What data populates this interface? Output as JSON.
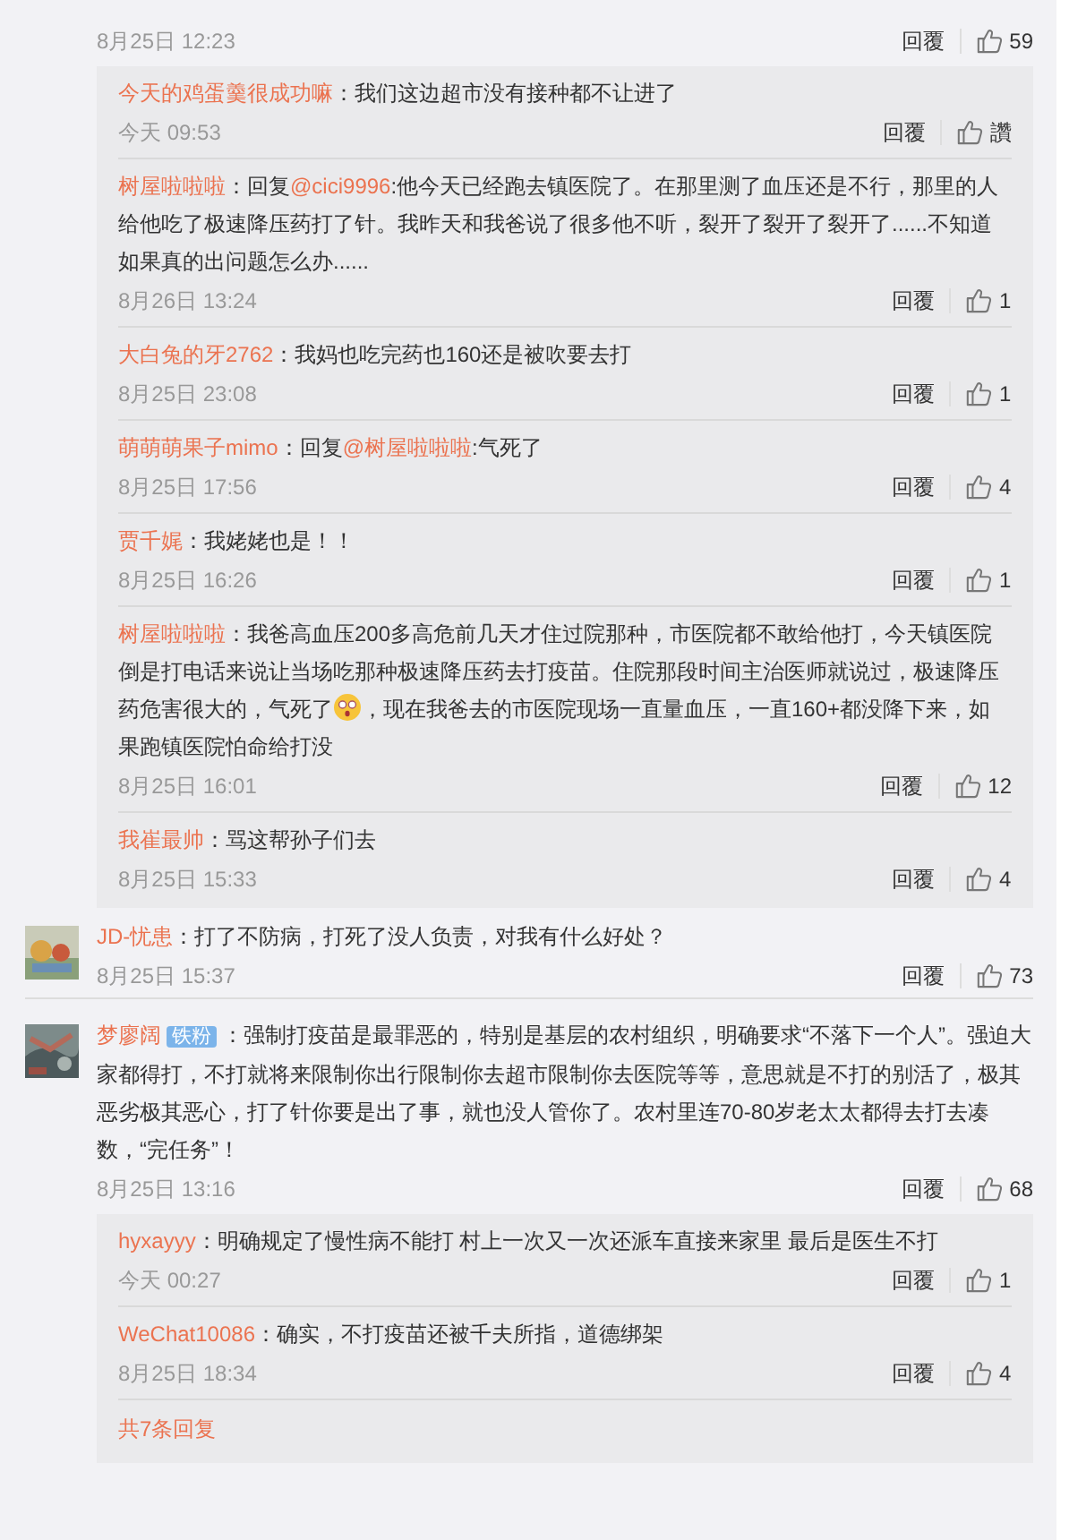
{
  "top_comment": {
    "date": "8月25日 12:23",
    "reply_label": "回覆",
    "likes": "59",
    "replies": [
      {
        "user": "今天的鸡蛋羹很成功嘛",
        "parts": [
          {
            "kind": "text",
            "text": "：我们这边超市没有接种都不让进了"
          }
        ],
        "date": "今天 09:53",
        "reply_label": "回覆",
        "likes": "讚"
      },
      {
        "user": "树屋啦啦啦",
        "parts": [
          {
            "kind": "text",
            "text": "：回复"
          },
          {
            "kind": "mention",
            "text": "@cici9996"
          },
          {
            "kind": "text",
            "text": ":他今天已经跑去镇医院了。在那里测了血压还是不行，那里的人给他吃了极速降压药打了针。我昨天和我爸说了很多他不听，裂开了裂开了裂开了......不知道如果真的出问题怎么办......"
          }
        ],
        "date": "8月26日 13:24",
        "reply_label": "回覆",
        "likes": "1"
      },
      {
        "user": "大白兔的牙2762",
        "parts": [
          {
            "kind": "text",
            "text": "：我妈也吃完药也160还是被吹要去打"
          }
        ],
        "date": "8月25日 23:08",
        "reply_label": "回覆",
        "likes": "1"
      },
      {
        "user": "萌萌萌果子mimo",
        "parts": [
          {
            "kind": "text",
            "text": "：回复"
          },
          {
            "kind": "mention",
            "text": "@树屋啦啦啦"
          },
          {
            "kind": "text",
            "text": ":气死了"
          }
        ],
        "date": "8月25日 17:56",
        "reply_label": "回覆",
        "likes": "4"
      },
      {
        "user": "贾千娓",
        "parts": [
          {
            "kind": "text",
            "text": "：我姥姥也是！！"
          }
        ],
        "date": "8月25日 16:26",
        "reply_label": "回覆",
        "likes": "1"
      },
      {
        "user": "树屋啦啦啦",
        "parts": [
          {
            "kind": "text",
            "text": "：我爸高血压200多高危前几天才住过院那种，市医院都不敢给他打，今天镇医院倒是打电话来说让当场吃那种极速降压药去打疫苗。住院那段时间主治医师就说过，极速降压药危害很大的，气死了"
          },
          {
            "kind": "emoji"
          },
          {
            "kind": "text",
            "text": "，现在我爸去的市医院现场一直量血压，一直160+都没降下来，如果跑镇医院怕命给打没"
          }
        ],
        "date": "8月25日 16:01",
        "reply_label": "回覆",
        "likes": "12"
      },
      {
        "user": "我崔最帅",
        "parts": [
          {
            "kind": "text",
            "text": "：骂这帮孙子们去"
          }
        ],
        "date": "8月25日 15:33",
        "reply_label": "回覆",
        "likes": "4"
      }
    ]
  },
  "comments": [
    {
      "avatar": {
        "kind": "picture"
      },
      "user": "JD-忧患",
      "parts": [
        {
          "kind": "text",
          "text": "：打了不防病，打死了没人负责，对我有什么好处？"
        }
      ],
      "date": "8月25日 15:37",
      "reply_label": "回覆",
      "likes": "73"
    },
    {
      "avatar": {
        "kind": "picture"
      },
      "user": "梦廖阔",
      "badge": "铁粉",
      "parts": [
        {
          "kind": "text",
          "text": "：强制打疫苗是最罪恶的，特别是基层的农村组织，明确要求“不落下一个人”。强迫大家都得打，不打就将来限制你出行限制你去超市限制你去医院等等，意思就是不打的别活了，极其恶劣极其恶心，打了针你要是出了事，就也没人管你了。农村里连70-80岁老太太都得去打去凑数，“完任务”！"
        }
      ],
      "date": "8月25日 13:16",
      "reply_label": "回覆",
      "likes": "68",
      "replies": [
        {
          "user": "hyxayyy",
          "parts": [
            {
              "kind": "text",
              "text": "：明确规定了慢性病不能打 村上一次又一次还派车直接来家里 最后是医生不打"
            }
          ],
          "date": "今天 00:27",
          "reply_label": "回覆",
          "likes": "1"
        },
        {
          "user": "WeChat10086",
          "parts": [
            {
              "kind": "text",
              "text": "：确实，不打疫苗还被千夫所指，道德绑架"
            }
          ],
          "date": "8月25日 18:34",
          "reply_label": "回覆",
          "likes": "4"
        }
      ],
      "more_link": "共7条回复"
    }
  ]
}
